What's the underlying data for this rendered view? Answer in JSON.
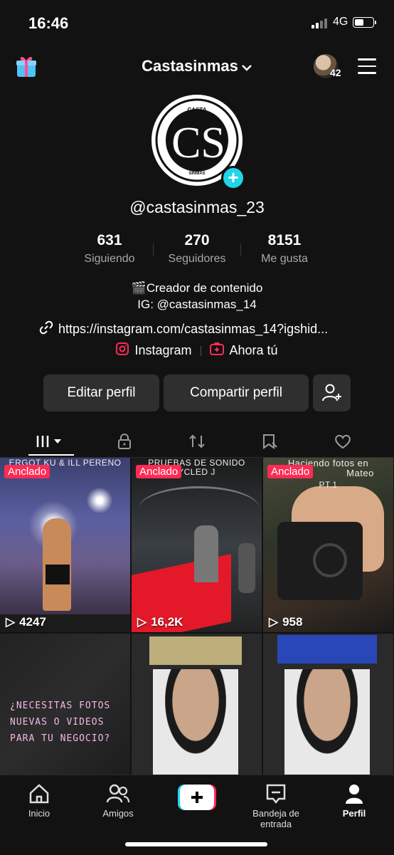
{
  "status_bar": {
    "time": "16:46",
    "network": "4G"
  },
  "header": {
    "title": "Castasinmas",
    "avatar_count": "42",
    "icons": [
      "gift-icon",
      "chevron-down-icon",
      "menu-icon"
    ]
  },
  "profile": {
    "logo": {
      "top_text": "CASTA",
      "monogram": "CS",
      "bottom_text": "SINMAS"
    },
    "handle": "@castasinmas_23",
    "stats": [
      {
        "value": "631",
        "label": "Siguiendo"
      },
      {
        "value": "270",
        "label": "Seguidores"
      },
      {
        "value": "8151",
        "label": "Me gusta"
      }
    ],
    "bio_line1": "🎬Creador de contenido",
    "bio_line2": "IG: @castasinmas_14",
    "link": "https://instagram.com/castasinmas_14?igshid...",
    "social": {
      "instagram": "Instagram",
      "ahora": "Ahora tú"
    }
  },
  "buttons": {
    "edit": "Editar perfil",
    "share": "Compartir perfil"
  },
  "grid": [
    {
      "pinned": "Anclado",
      "views": "4247",
      "caption": "ERGOT KU & ILL PERENO"
    },
    {
      "pinned": "Anclado",
      "views": "16,2K",
      "caption": "PRUEBAS DE SONIDO",
      "caption2": "YCLED J"
    },
    {
      "pinned": "Anclado",
      "views": "958",
      "caption": "Haciendo fotos en",
      "caption2": "Mateo",
      "caption3": "PT.1"
    },
    {
      "text_lines": [
        "¿NECESITAS FOTOS",
        "NUEVAS O VIDEOS",
        "PARA TU NEGOCIO?"
      ]
    },
    {},
    {}
  ],
  "bottom_nav": [
    {
      "label": "Inicio"
    },
    {
      "label": "Amigos"
    },
    {
      "label": ""
    },
    {
      "label": "Bandeja de entrada"
    },
    {
      "label": "Perfil"
    }
  ],
  "colors": {
    "accent": "#fe2c55",
    "cyan": "#20d5ec",
    "background": "#121212",
    "button": "#2f2f2f"
  }
}
